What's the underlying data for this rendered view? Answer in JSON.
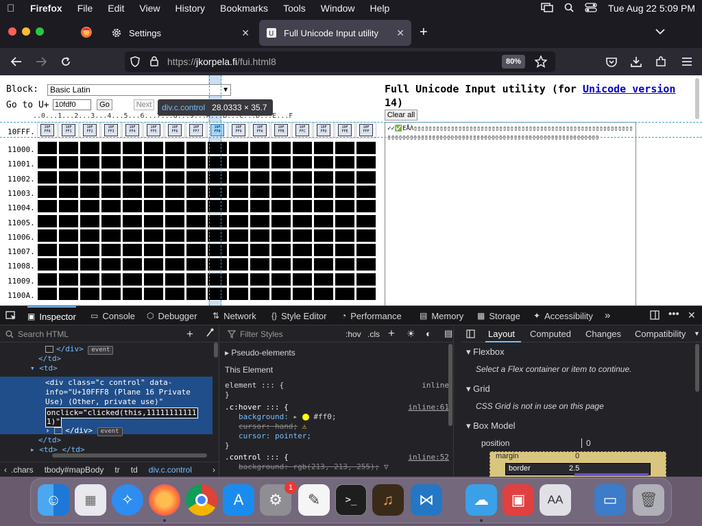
{
  "menubar": {
    "app": "Firefox",
    "items": [
      "File",
      "Edit",
      "View",
      "History",
      "Bookmarks",
      "Tools",
      "Window",
      "Help"
    ],
    "clock": "Tue Aug 22  5:09 PM"
  },
  "tabs": [
    {
      "label": "Settings",
      "icon": "gear-icon"
    },
    {
      "label": "Full Unicode Input utility",
      "icon": "page-icon"
    }
  ],
  "navbar": {
    "url_prefix": "https://",
    "url_host": "jkorpela.fi",
    "url_path": "/fui.html8",
    "zoom": "80%"
  },
  "page": {
    "block_label": "Block:",
    "block_value": "Basic Latin",
    "goto_label": "Go to U+",
    "goto_value": "10fdf0",
    "go_label": "Go",
    "next_label": "Next",
    "tooltip_selector": "div.c.control",
    "tooltip_dims": "28.0333 × 35.7",
    "column_header": "..0...1...2...3...4...5...6...7...8...9...A...B...C...D...E...F",
    "rows": [
      "10FFF.",
      "11000.",
      "11001.",
      "11002.",
      "11003.",
      "11004.",
      "11005.",
      "11006.",
      "11007.",
      "11008.",
      "11009.",
      "1100A."
    ],
    "glyph_codes": [
      "10F FF0",
      "10F FF1",
      "10F FF2",
      "10F FF3",
      "10F FF4",
      "10F FF5",
      "10F FF6",
      "10F FF7",
      "10F FF8",
      "10F FF9",
      "10F FFA",
      "10F FFB",
      "10F FFC",
      "10F FFD",
      "10F FFE",
      "10F FFF"
    ],
    "title_prefix": "Full Unicode Input utility (for ",
    "title_link": "Unicode version",
    "title_suffix": " 14)",
    "clear_all": "Clear all",
    "output_text": "✓✓✅ΕÅΛ▯▯▯▯▯▯▯▯▯▯▯▯▯▯▯▯▯▯▯▯▯▯▯▯▯▯▯▯▯▯▯▯▯▯▯▯▯▯▯▯▯▯▯▯▯▯▯▯▯▯▯▯▯▯▯▯▯▯▯▯▯▯▯▯▯▯▯▯▯▯▯▯▯▯▯▯▯▯▯▯▯▯▯▯▯▯▯▯▯▯▯▯▯▯▯▯▯▯▯▯▯▯▯▯▯▯▯▯▯▯▯▯▯▯▯▯"
  },
  "devtools": {
    "tabs": [
      "Inspector",
      "Console",
      "Debugger",
      "Network",
      "Style Editor",
      "Performance",
      "Memory",
      "Storage",
      "Accessibility"
    ],
    "search_placeholder": "Search HTML",
    "filter_placeholder": "Filter Styles",
    "hov": ":hov",
    "cls": ".cls",
    "markup": {
      "line1": "</div>",
      "event": "event",
      "line2": "</td>",
      "line3": "<td>",
      "sel1": "<div class=\"c control\" data-",
      "sel2": "info=\"U+10FFF8 (Plane 16 Private",
      "sel3": "Use) (Other, private use)\"",
      "sel4": "onclick=\"clicked(this,11111111111",
      "sel5": "1)\"",
      "line4": "</div>",
      "line5": "</td>",
      "line6": "<td> </td>"
    },
    "breadcrumbs": [
      ".chars",
      "tbody#mapBody",
      "tr",
      "td",
      "div.c.control"
    ],
    "rules": {
      "pseudo": "Pseudo-elements",
      "this_element": "This Element",
      "element_rule": "element ::: {",
      "inline": "inline",
      "close": "}",
      "hover_sel": ".c:hover ::: {",
      "hover_src": "inline:61",
      "bg_prop": "background:",
      "bg_val": "#ff0;",
      "cursor_hand": "cursor: hand;",
      "cursor_pointer": "cursor: pointer;",
      "control_sel": ".control ::: {",
      "control_src": "inline:52",
      "control_bg": "background: rgb(213, 213, 255);"
    },
    "layout": {
      "tabs": [
        "Layout",
        "Computed",
        "Changes",
        "Compatibility"
      ],
      "flexbox": "Flexbox",
      "flex_msg": "Select a Flex container or item to continue.",
      "grid": "Grid",
      "grid_msg": "CSS Grid is not in use on this page",
      "boxmodel": "Box Model",
      "position": "position",
      "position_val": "0",
      "margin": "margin",
      "margin_val": "0",
      "border": "border",
      "border_val": "2.5"
    }
  },
  "colors": {
    "accent": "#75bfff",
    "selection": "#204e8a",
    "hover_yellow": "#ffff00"
  }
}
